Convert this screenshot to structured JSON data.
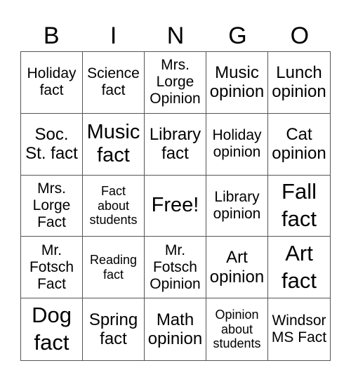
{
  "header": {
    "letters": [
      "B",
      "I",
      "N",
      "G",
      "O"
    ]
  },
  "cells": [
    {
      "text": "Holiday\nfact",
      "size": "md"
    },
    {
      "text": "Science\nfact",
      "size": "md"
    },
    {
      "text": "Mrs.\nLorge\nOpinion",
      "size": "md"
    },
    {
      "text": "Music\nopinion",
      "size": "lg"
    },
    {
      "text": "Lunch\nopinion",
      "size": "lg"
    },
    {
      "text": "Soc.\nSt. fact",
      "size": "lg"
    },
    {
      "text": "Music\nfact",
      "size": "xl"
    },
    {
      "text": "Library\nfact",
      "size": "lg"
    },
    {
      "text": "Holiday\nopinion",
      "size": "md"
    },
    {
      "text": "Cat\nopinion",
      "size": "lg"
    },
    {
      "text": "Mrs.\nLorge\nFact",
      "size": "md"
    },
    {
      "text": "Fact\nabout\nstudents",
      "size": "sm"
    },
    {
      "text": "Free!",
      "size": "xl"
    },
    {
      "text": "Library\nopinion",
      "size": "md"
    },
    {
      "text": "Fall\nfact",
      "size": "xxl"
    },
    {
      "text": "Mr.\nFotsch\nFact",
      "size": "md"
    },
    {
      "text": "Reading\nfact",
      "size": "sm"
    },
    {
      "text": "Mr.\nFotsch\nOpinion",
      "size": "md"
    },
    {
      "text": "Art\nopinion",
      "size": "lg"
    },
    {
      "text": "Art\nfact",
      "size": "xxl"
    },
    {
      "text": "Dog\nfact",
      "size": "xxl"
    },
    {
      "text": "Spring\nfact",
      "size": "lg"
    },
    {
      "text": "Math\nopinion",
      "size": "lg"
    },
    {
      "text": "Opinion\nabout\nstudents",
      "size": "sm"
    },
    {
      "text": "Windsor\nMS Fact",
      "size": "md"
    }
  ]
}
